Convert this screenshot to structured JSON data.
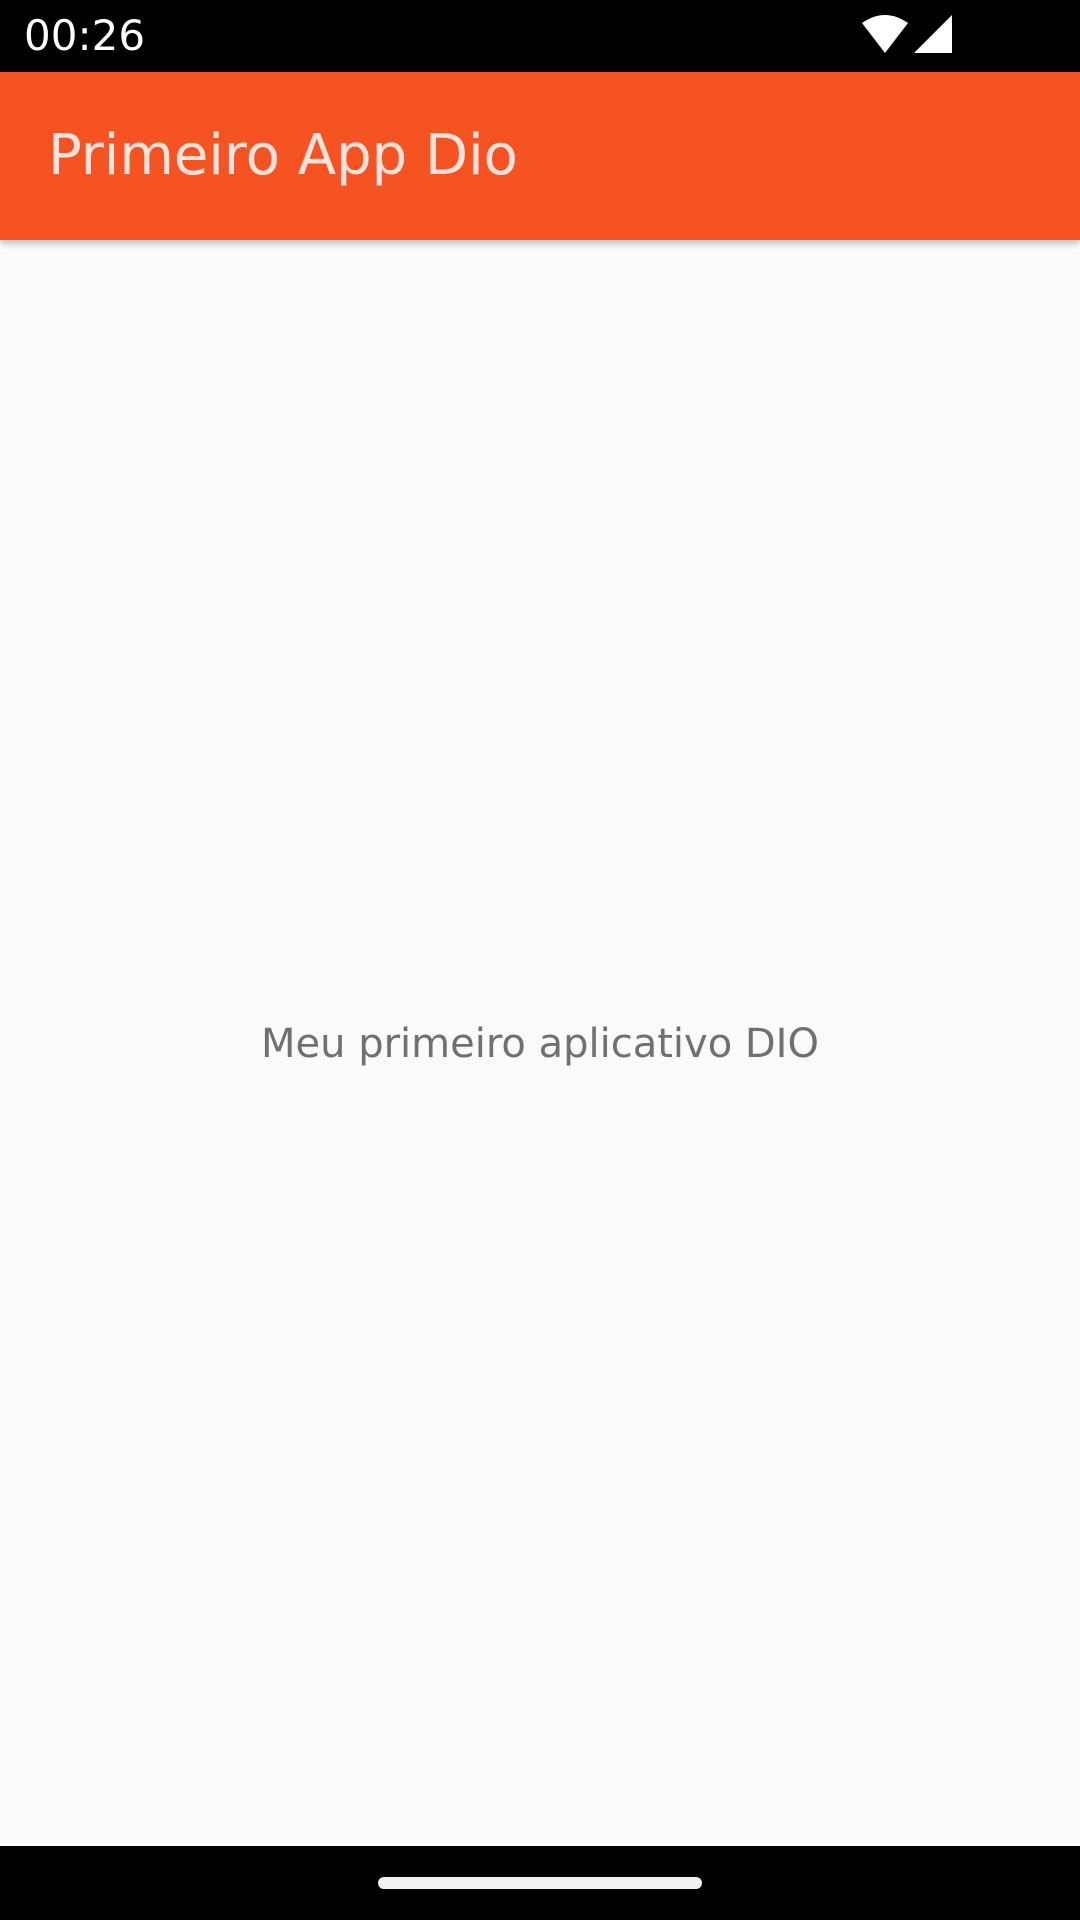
{
  "status_bar": {
    "time": "00:26",
    "icons": [
      "wifi-icon",
      "cellular-signal-icon"
    ]
  },
  "app_bar": {
    "title": "Primeiro App Dio"
  },
  "main": {
    "text": "Meu primeiro aplicativo DIO"
  },
  "colors": {
    "app_bar_background": "#f65322",
    "app_bar_title": "#fde3db",
    "body_background": "#fafafa",
    "body_text": "#707070",
    "system_bars": "#000000"
  }
}
